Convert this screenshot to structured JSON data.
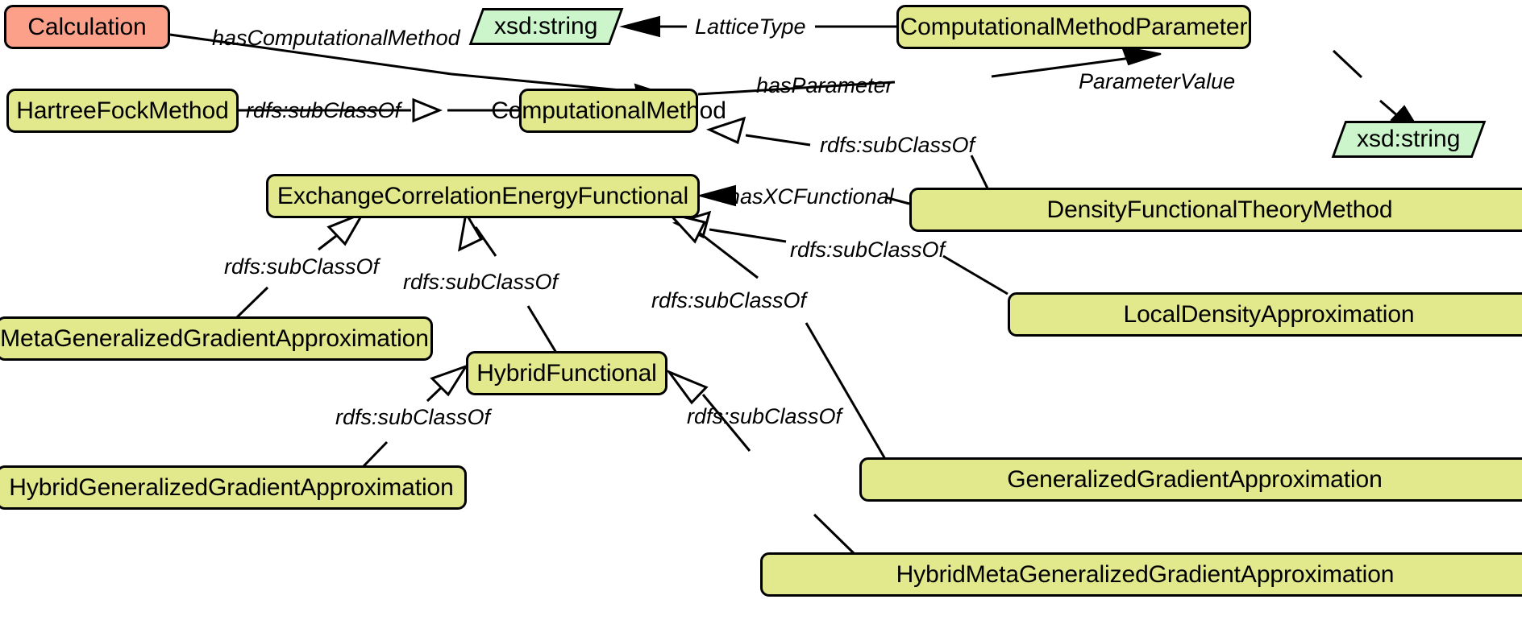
{
  "diagram": {
    "kind": "ontology-class-diagram",
    "colors": {
      "class_fill": "#E2E88C",
      "root_fill": "#FCA08A",
      "datatype_fill": "#CCF5CC",
      "stroke": "#000000",
      "background": "#FFFFFF"
    },
    "nodes": [
      {
        "id": "calculation",
        "label": "Calculation",
        "type": "class-root"
      },
      {
        "id": "hartreefock",
        "label": "HartreeFockMethod",
        "type": "class"
      },
      {
        "id": "computationalmethod",
        "label": "ComputationalMethod",
        "type": "class"
      },
      {
        "id": "xsdstring1",
        "label": "xsd:string",
        "type": "datatype"
      },
      {
        "id": "computationalmethodparameter",
        "label": "ComputationalMethodParameter",
        "type": "class"
      },
      {
        "id": "xsdstring2",
        "label": "xsd:string",
        "type": "datatype"
      },
      {
        "id": "exchangecorrelation",
        "label": "ExchangeCorrelationEnergyFunctional",
        "type": "class"
      },
      {
        "id": "dftmethod",
        "label": "DensityFunctionalTheoryMethod",
        "type": "class"
      },
      {
        "id": "lda",
        "label": "LocalDensityApproximation",
        "type": "class"
      },
      {
        "id": "mgga",
        "label": "MetaGeneralizedGradientApproximation",
        "type": "class"
      },
      {
        "id": "hybridfunctional",
        "label": "HybridFunctional",
        "type": "class"
      },
      {
        "id": "gga",
        "label": "GeneralizedGradientApproximation",
        "type": "class"
      },
      {
        "id": "hgga",
        "label": "HybridGeneralizedGradientApproximation",
        "type": "class"
      },
      {
        "id": "hmgga",
        "label": "HybridMetaGeneralizedGradientApproximation",
        "type": "class"
      }
    ],
    "edges": [
      {
        "id": "e1",
        "label": "hasComputationalMethod",
        "from": "calculation",
        "to": "computationalmethod",
        "arrow": "filled"
      },
      {
        "id": "e2",
        "label": "rdfs:subClassOf",
        "from": "hartreefock",
        "to": "computationalmethod",
        "arrow": "hollow"
      },
      {
        "id": "e3",
        "label": "LatticeType",
        "from": "computationalmethodparameter",
        "to": "xsdstring1",
        "arrow": "filled"
      },
      {
        "id": "e4",
        "label": "hasParameter",
        "from": "computationalmethod",
        "to": "computationalmethodparameter",
        "arrow": "filled"
      },
      {
        "id": "e5",
        "label": "ParameterValue",
        "from": "computationalmethodparameter",
        "to": "xsdstring2",
        "arrow": "filled"
      },
      {
        "id": "e6",
        "label": "rdfs:subClassOf",
        "from": "dftmethod",
        "to": "computationalmethod",
        "arrow": "hollow"
      },
      {
        "id": "e7",
        "label": "hasXCFunctional",
        "from": "dftmethod",
        "to": "exchangecorrelation",
        "arrow": "filled"
      },
      {
        "id": "e8",
        "label": "rdfs:subClassOf",
        "from": "lda",
        "to": "exchangecorrelation",
        "arrow": "hollow"
      },
      {
        "id": "e9",
        "label": "rdfs:subClassOf",
        "from": "mgga",
        "to": "exchangecorrelation",
        "arrow": "hollow"
      },
      {
        "id": "e10",
        "label": "rdfs:subClassOf",
        "from": "hybridfunctional",
        "to": "exchangecorrelation",
        "arrow": "hollow"
      },
      {
        "id": "e11",
        "label": "rdfs:subClassOf",
        "from": "gga",
        "to": "exchangecorrelation",
        "arrow": "hollow"
      },
      {
        "id": "e12",
        "label": "rdfs:subClassOf",
        "from": "hgga",
        "to": "hybridfunctional",
        "arrow": "hollow"
      },
      {
        "id": "e13",
        "label": "rdfs:subClassOf",
        "from": "hmgga",
        "to": "hybridfunctional",
        "arrow": "hollow"
      }
    ]
  }
}
